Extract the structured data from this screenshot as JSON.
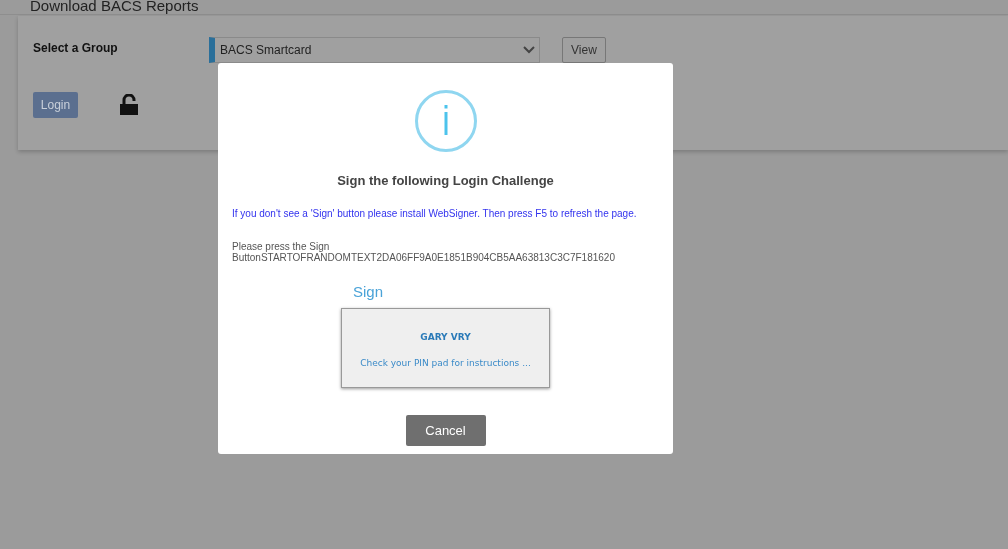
{
  "page": {
    "title": "Download BACS Reports"
  },
  "form": {
    "group_label": "Select a Group",
    "group_select": {
      "value": "BACS Smartcard"
    },
    "view_button": "View",
    "login_button": "Login",
    "locked": false
  },
  "dialog": {
    "title": "Sign the following Login Challenge",
    "notice": "If you don't see a 'Sign' button please install WebSigner. Then press F5 to refresh the page.",
    "challenge_lines": [
      "Please press the Sign",
      "ButtonSTARTOFRANDOMTEXT2DA06FF9A0E1851B904CB5AA63813C3C7F181620"
    ],
    "sign_heading": "Sign",
    "signer": {
      "name": "GARY VRY",
      "instruction": "Check your PIN pad for instructions ..."
    },
    "cancel_button": "Cancel"
  }
}
